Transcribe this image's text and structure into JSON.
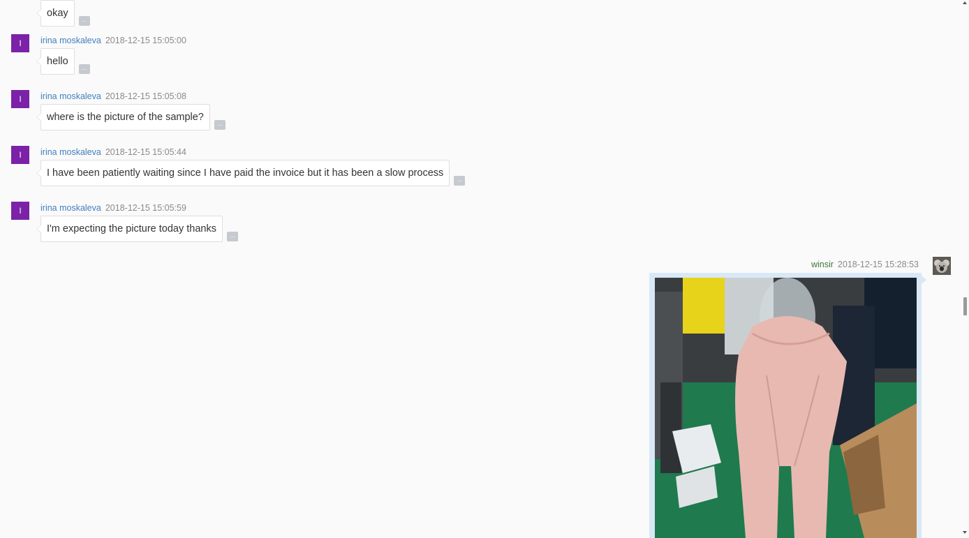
{
  "messages": [
    {
      "sender": "",
      "time": "",
      "text": "okay",
      "show_header": false
    },
    {
      "sender": "irina moskaleva",
      "time": "2018-12-15 15:05:00",
      "text": "hello",
      "avatar": "I"
    },
    {
      "sender": "irina moskaleva",
      "time": "2018-12-15 15:05:08",
      "text": "where is the picture of the sample?",
      "avatar": "I"
    },
    {
      "sender": "irina moskaleva",
      "time": "2018-12-15 15:05:44",
      "text": "I have been patiently waiting since I have paid the invoice but it has been a slow process",
      "avatar": "I"
    },
    {
      "sender": "irina moskaleva",
      "time": "2018-12-15 15:05:59",
      "text": "I'm expecting the picture today thanks",
      "avatar": "I"
    }
  ],
  "more_button_label": "...",
  "reply": {
    "sender": "winsir",
    "time": "2018-12-15 15:28:53",
    "attachment": "photo of pink leggings sample on mannequin"
  },
  "colors": {
    "avatar_bg": "#7b22a8",
    "sender_name": "#3f7fbf",
    "reply_sender_name": "#3b7a3b",
    "image_frame": "#d9e8f6"
  }
}
